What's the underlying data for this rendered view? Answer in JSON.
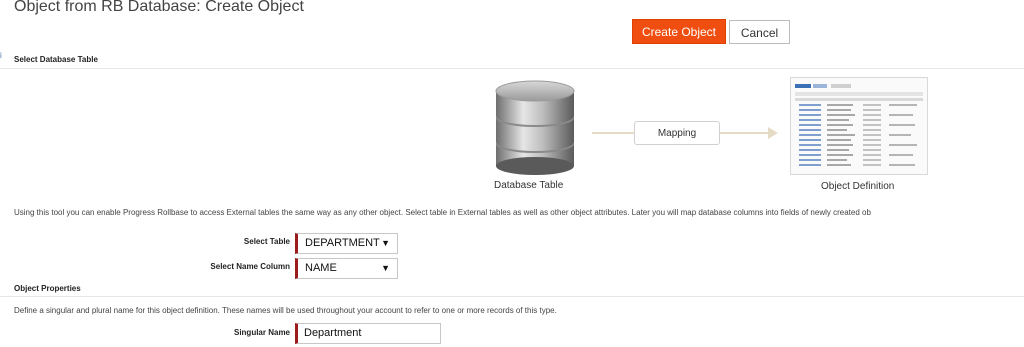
{
  "page": {
    "title": "Object from RB Database: Create Object"
  },
  "toolbar": {
    "create_label": "Create Object",
    "cancel_label": "Cancel"
  },
  "select_table_section": {
    "header": "Select Database Table",
    "database_table_caption": "Database Table",
    "mapping_label": "Mapping",
    "object_definition_caption": "Object Definition",
    "description": "Using this tool you can enable Progress Rollbase to access External tables the same way as any other object. Select table in External tables as well as other object attributes. Later you will map database columns into fields of newly created ob",
    "select_table_label": "Select Table",
    "select_table_value": "DEPARTMENT",
    "select_name_column_label": "Select Name Column",
    "select_name_column_value": "NAME"
  },
  "object_properties_section": {
    "header": "Object Properties",
    "description": "Define a singular and plural name for this object definition. These names will be used throughout your account to refer to one or more records of this type.",
    "singular_name_label": "Singular Name",
    "singular_name_value": "Department"
  },
  "icons": {
    "database": "database-icon",
    "dropdown": "caret-down-icon",
    "arrow": "arrow-right-icon"
  },
  "colors": {
    "accent": "#f04e10",
    "required_marker": "#9b1c1c"
  }
}
